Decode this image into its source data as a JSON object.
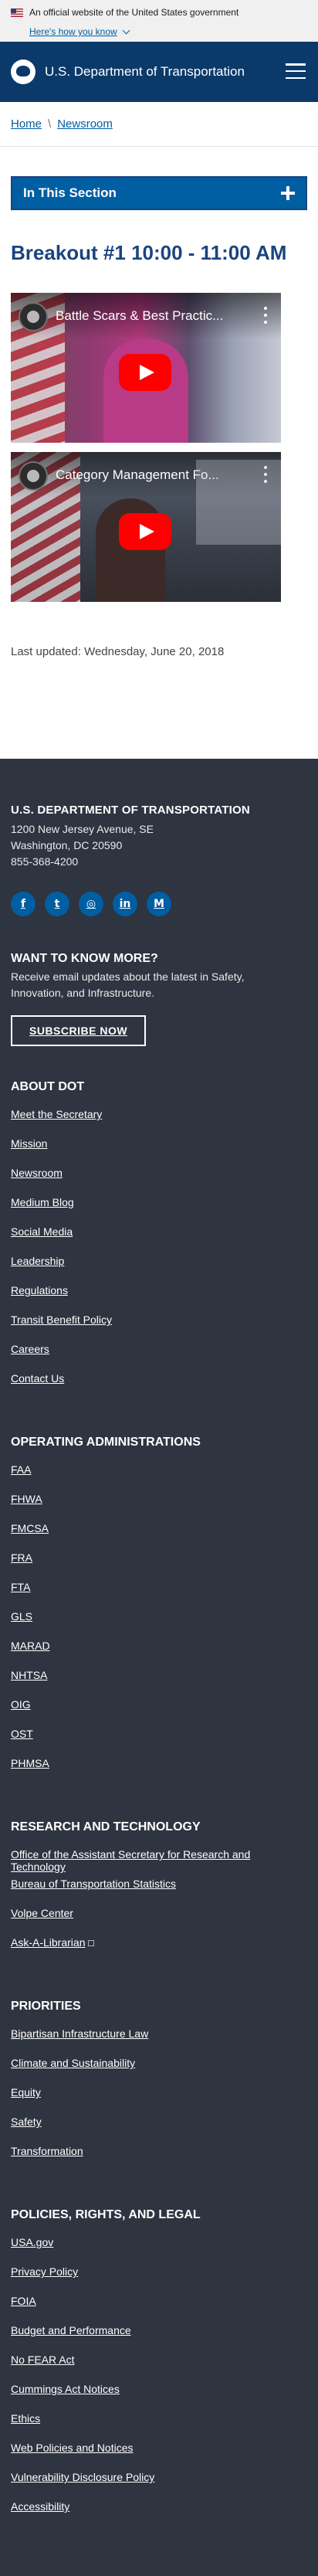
{
  "gov_banner": {
    "text": "An official website of the United States government",
    "how_text": "Here's how you know"
  },
  "header": {
    "site_title": "U.S. Department of Transportation",
    "menu_icon": "hamburger-menu-icon"
  },
  "breadcrumb": {
    "items": [
      "Home",
      "Newsroom"
    ],
    "separator": "\\"
  },
  "section_nav": {
    "label": "In This Section"
  },
  "page": {
    "title": "Breakout #1 10:00 - 11:00 AM",
    "videos": [
      {
        "title": "Battle Scars & Best Practic..."
      },
      {
        "title": "Category Management Fo..."
      }
    ],
    "last_updated": "Last updated: Wednesday, June 20, 2018"
  },
  "footer": {
    "org_name": "U.S. DEPARTMENT OF TRANSPORTATION",
    "address_line1": "1200 New Jersey Avenue, SE",
    "address_line2": "Washington, DC 20590",
    "phone": "855-368-4200",
    "social": [
      {
        "icon": "facebook-icon",
        "glyph": "f"
      },
      {
        "icon": "twitter-icon",
        "glyph": "t"
      },
      {
        "icon": "instagram-icon",
        "glyph": "◎"
      },
      {
        "icon": "linkedin-icon",
        "glyph": "in"
      },
      {
        "icon": "medium-icon",
        "glyph": "M"
      }
    ],
    "want_title": "WANT TO KNOW MORE?",
    "want_desc": "Receive email updates about the latest in Safety, Innovation, and Infrastructure.",
    "subscribe_label": "SUBSCRIBE NOW",
    "sections": [
      {
        "title": "ABOUT DOT",
        "links": [
          "Meet the Secretary",
          "Mission",
          "Newsroom",
          "Medium Blog",
          "Social Media",
          "Leadership",
          "Regulations",
          "Transit Benefit Policy",
          "Careers",
          "Contact Us"
        ]
      },
      {
        "title": "OPERATING ADMINISTRATIONS",
        "links": [
          "FAA",
          "FHWA",
          "FMCSA",
          "FRA",
          "FTA",
          "GLS",
          "MARAD",
          "NHTSA",
          "OIG",
          "OST",
          "PHMSA"
        ]
      },
      {
        "title": "RESEARCH AND TECHNOLOGY",
        "links": [
          "Office of the Assistant Secretary for Research and Technology",
          "Bureau of Transportation Statistics",
          "Volpe Center",
          "Ask-A-Librarian"
        ]
      },
      {
        "title": "PRIORITIES",
        "links": [
          "Bipartisan Infrastructure Law",
          "Climate and Sustainability",
          "Equity",
          "Safety",
          "Transformation"
        ]
      },
      {
        "title": "POLICIES, RIGHTS, AND LEGAL",
        "links": [
          "USA.gov",
          "Privacy Policy",
          "FOIA",
          "Budget and Performance",
          "No FEAR Act",
          "Cummings Act Notices",
          "Ethics",
          "Web Policies and Notices",
          "Vulnerability Disclosure Policy",
          "Accessibility"
        ]
      }
    ]
  },
  "colors": {
    "header_bg": "#0b3a6a",
    "accent": "#005ea2",
    "title": "#1a4480",
    "footer_bg": "#2e3440",
    "play_red": "#ff0000"
  }
}
